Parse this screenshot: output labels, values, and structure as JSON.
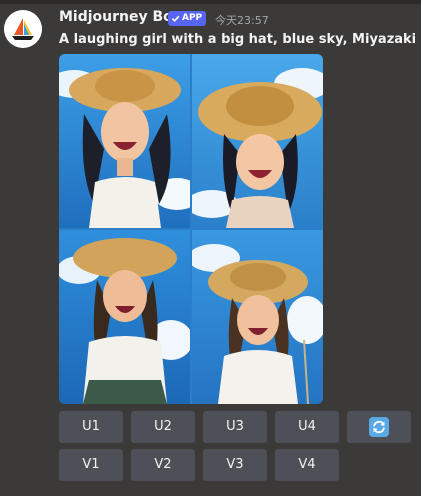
{
  "message": {
    "author": "Midjourney Bot",
    "badge": "APP",
    "timestamp": "今天23:57",
    "prompt": "A laughing girl with a big hat, blue sky, Miyazaki sty"
  },
  "image_grid": {
    "tiles": [
      {
        "name": "image-1"
      },
      {
        "name": "image-2"
      },
      {
        "name": "image-3"
      },
      {
        "name": "image-4"
      }
    ]
  },
  "buttons": {
    "upscale": [
      "U1",
      "U2",
      "U3",
      "U4"
    ],
    "variation": [
      "V1",
      "V2",
      "V3",
      "V4"
    ],
    "reroll_icon": "refresh-icon"
  },
  "colors": {
    "background": "#3b3a38",
    "button": "#4e5058",
    "badge": "#5865f2",
    "refresh_icon": "#5aa9e6"
  }
}
